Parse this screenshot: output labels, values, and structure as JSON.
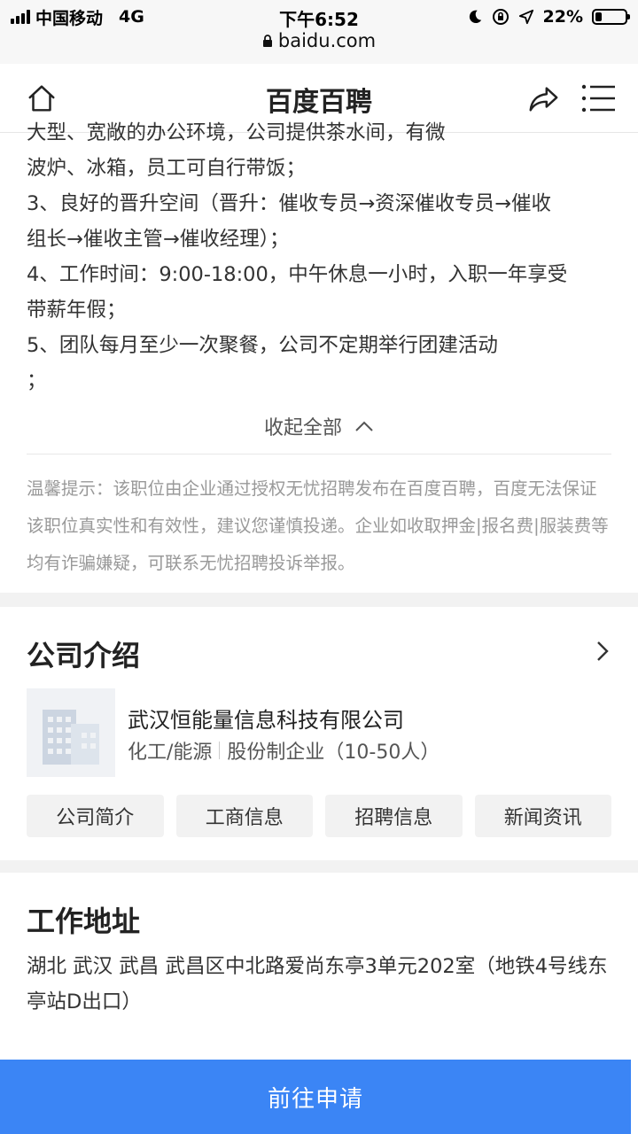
{
  "status_bar": {
    "carrier": "中国移动",
    "network": "4G",
    "time": "下午6:52",
    "battery": "22%",
    "url": "baidu.com"
  },
  "nav": {
    "title": "百度百聘"
  },
  "description": {
    "lines": [
      "大型、宽敞的办公环境，公司提供茶水间，有微",
      "波炉、冰箱，员工可自行带饭；",
      "3、良好的晋升空间（晋升：催收专员→资深催收专员→催收",
      "组长→催收主管→催收经理）；",
      "4、工作时间：9:00-18:00，中午休息一小时，入职一年享受",
      "带薪年假；",
      "5、团队每月至少一次聚餐，公司不定期举行团建活动",
      "；"
    ],
    "collapse_label": "收起全部"
  },
  "tip": {
    "text": "温馨提示：该职位由企业通过授权无忧招聘发布在百度百聘，百度无法保证该职位真实性和有效性，建议您谨慎投递。企业如收取押金|报名费|服装费等均有诈骗嫌疑，可联系无忧招聘投诉举报。"
  },
  "company": {
    "section_title": "公司介绍",
    "name": "武汉恒能量信息科技有限公司",
    "industry": "化工/能源",
    "type_size": "股份制企业（10-50人）",
    "tabs": [
      "公司简介",
      "工商信息",
      "招聘信息",
      "新闻资讯"
    ]
  },
  "address": {
    "section_title": "工作地址",
    "text": "湖北 武汉 武昌 武昌区中北路爱尚东亭3单元202室（地铁4号线东亭站D出口）"
  },
  "apply_button": {
    "label": "前往申请"
  },
  "colors": {
    "accent": "#3b85f5",
    "tip_text": "#999999"
  }
}
